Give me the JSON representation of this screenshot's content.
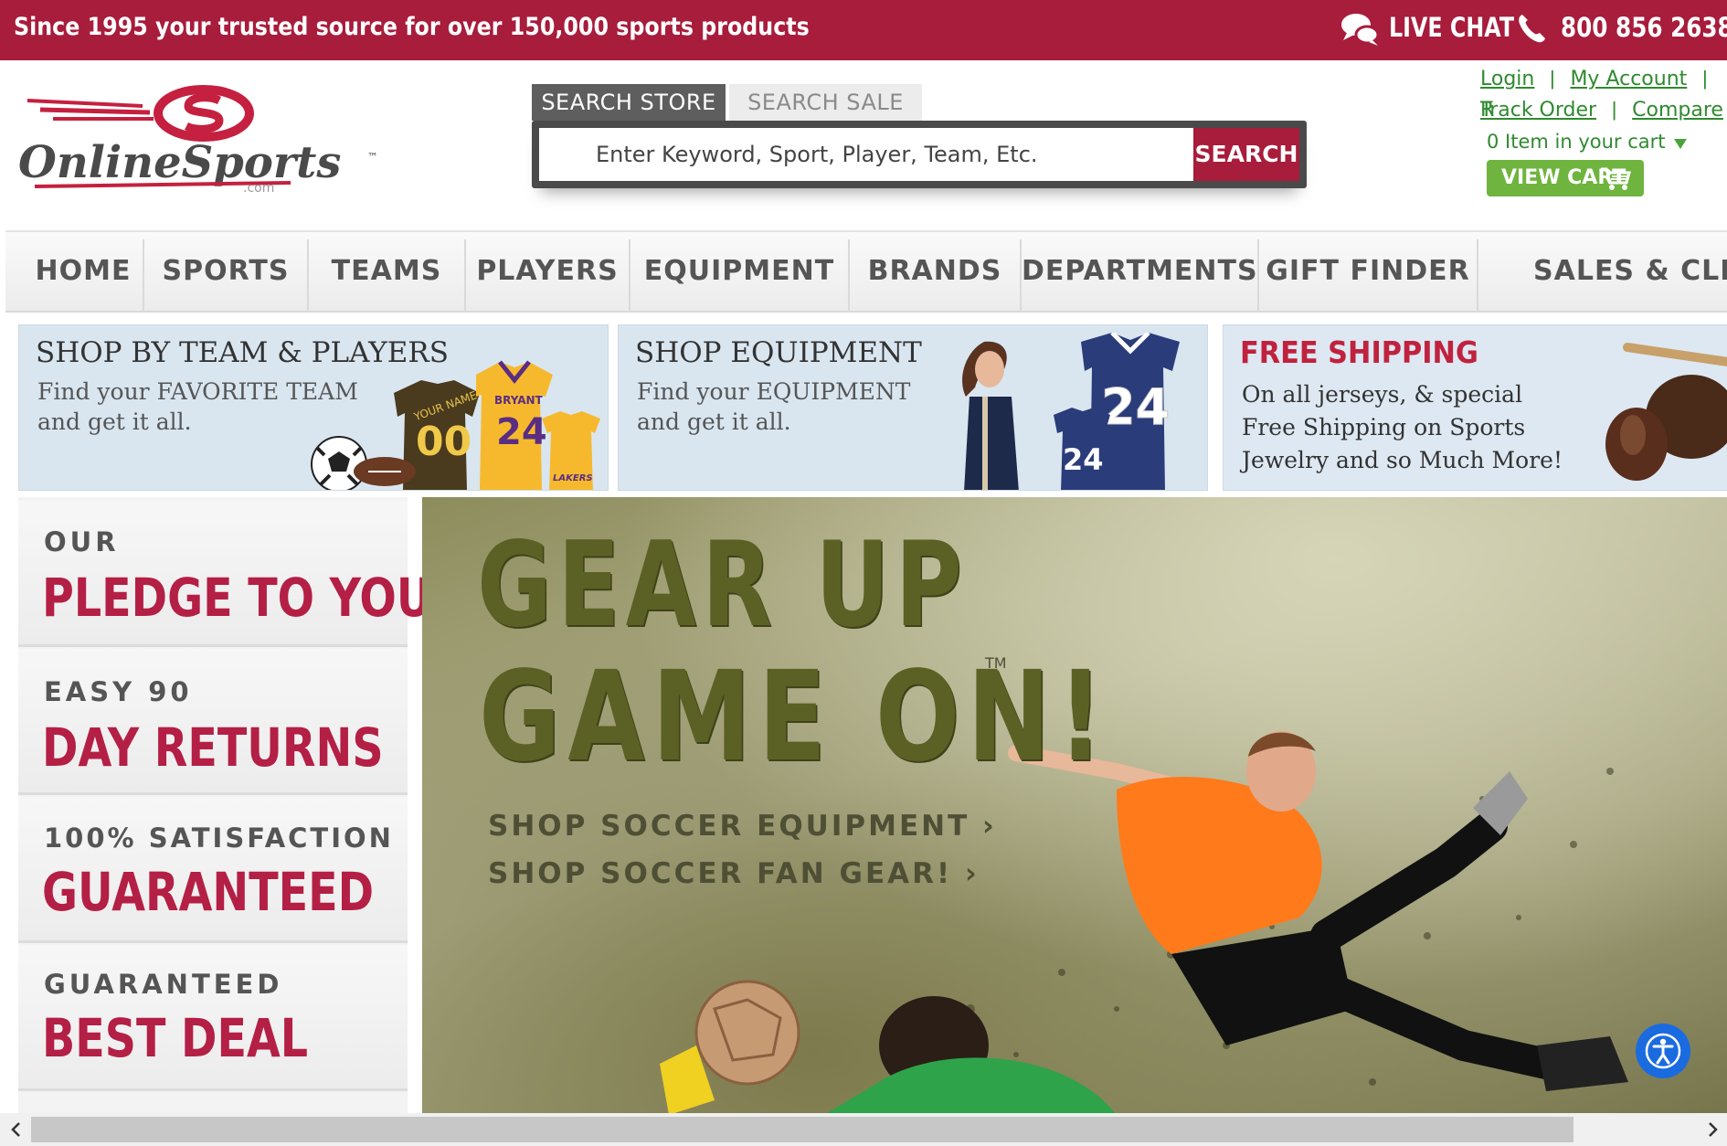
{
  "topbar": {
    "tagline": "Since 1995 your trusted source for over 150,000 sports products",
    "live_chat": "LIVE CHAT",
    "phone": "800 856 2638"
  },
  "brand": {
    "logo_text": "OnlineSports",
    "logo_tm": "™",
    "logo_com": ".com",
    "color": "#a81c3c"
  },
  "search": {
    "tab_store": "SEARCH STORE",
    "tab_sale": "SEARCH SALE",
    "placeholder": "Enter Keyword, Sport, Player, Team, Etc.",
    "button": "SEARCH"
  },
  "account": {
    "login": "Login",
    "my_account": "My Account",
    "register_partial": "R",
    "track_order": "Track Order",
    "compare": "Compare",
    "cart_count": "0 Item in your cart",
    "view_cart": "VIEW CART",
    "link_color": "#2f8a2f"
  },
  "nav": {
    "items": [
      "HOME",
      "SPORTS",
      "TEAMS",
      "PLAYERS",
      "EQUIPMENT",
      "BRANDS",
      "DEPARTMENTS",
      "GIFT FINDER",
      "SALES & CLEARA"
    ]
  },
  "promos": [
    {
      "title": "SHOP BY TEAM & PLAYERS",
      "text": "Find your FAVORITE TEAM\nand get it all."
    },
    {
      "title": "SHOP EQUIPMENT",
      "text": "Find your EQUIPMENT\nand get it all."
    },
    {
      "title": "FREE SHIPPING",
      "text": "On all jerseys, & special\nFree Shipping on Sports\nJewelry and so Much More!"
    }
  ],
  "promo_art": {
    "jersey_name_1": "YOUR NAME",
    "jersey_num_1": "00",
    "jersey_name_2": "BRYANT",
    "jersey_num_2": "24",
    "jersey_team": "LAKERS",
    "jersey_num_3": "24",
    "jersey_num_4": "24"
  },
  "pledges": [
    {
      "small": "OUR",
      "big": "PLEDGE TO YOU"
    },
    {
      "small": "EASY 90",
      "big": "DAY RETURNS"
    },
    {
      "small": "100% SATISFACTION",
      "big": "GUARANTEED"
    },
    {
      "small": "GUARANTEED",
      "big": "BEST DEAL"
    }
  ],
  "hero": {
    "line1": "GEAR UP",
    "line2": "GAME ON!",
    "tm": "TM",
    "link1": "SHOP SOCCER EQUIPMENT",
    "link2": "SHOP SOCCER FAN GEAR!",
    "chevron": "›"
  }
}
